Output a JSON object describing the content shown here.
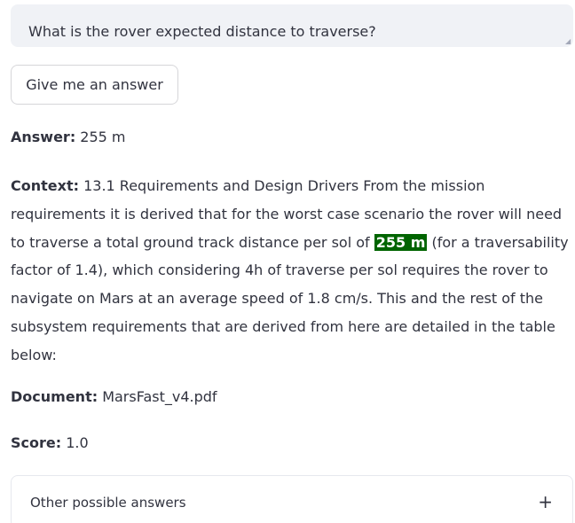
{
  "question": {
    "value": "What is the rover expected distance to traverse?"
  },
  "button": {
    "label": "Give me an answer"
  },
  "answer": {
    "label": "Answer:",
    "value": " 255 m"
  },
  "context": {
    "label": "Context:",
    "text_before": " 13.1 Requirements and Design Drivers From the mission requirements it is derived that for the worst case scenario the rover will need to traverse a total ground track distance per sol of ",
    "highlight": "255 m",
    "text_after": " (for a traversability factor of 1.4), which considering 4h of traverse per sol requires the rover to navigate on Mars at an average speed of 1.8 cm/s. This and the rest of the subsystem requirements that are derived from here are detailed in the table below:"
  },
  "document": {
    "label": "Document:",
    "value": " MarsFast_v4.pdf"
  },
  "score": {
    "label": "Score:",
    "value": " 1.0"
  },
  "expander": {
    "label": "Other possible answers",
    "icon": "plus-icon",
    "icon_glyph": "+"
  },
  "colors": {
    "highlight_bg": "#006400",
    "input_bg": "#f0f2f6",
    "text": "#31333f"
  }
}
